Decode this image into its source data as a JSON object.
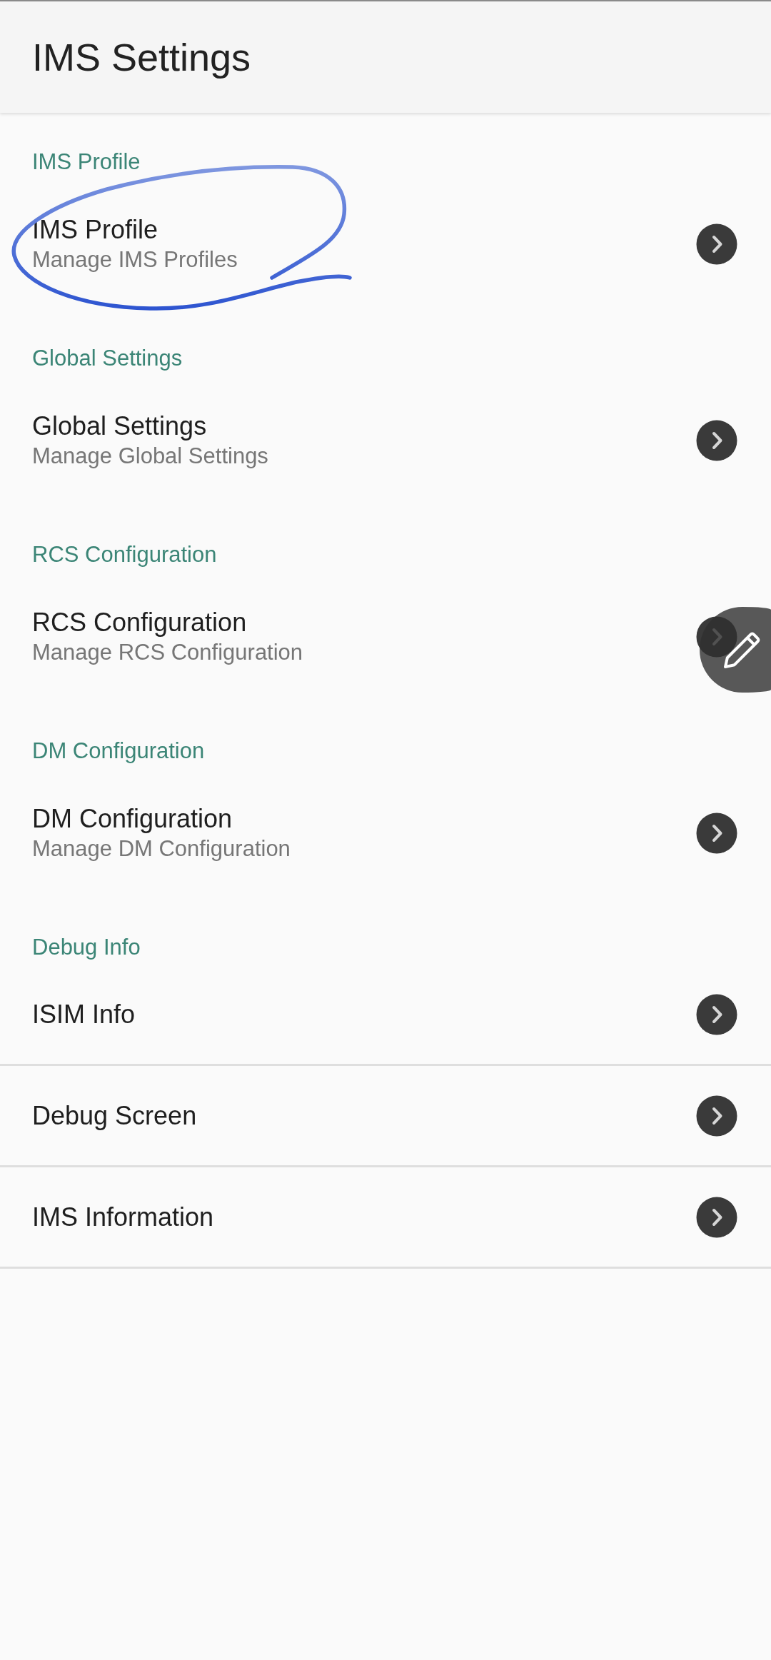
{
  "app_bar": {
    "title": "IMS Settings"
  },
  "sections": [
    {
      "header": "IMS Profile",
      "items": [
        {
          "title": "IMS Profile",
          "subtitle": "Manage IMS Profiles"
        }
      ]
    },
    {
      "header": "Global Settings",
      "items": [
        {
          "title": "Global Settings",
          "subtitle": "Manage Global Settings"
        }
      ]
    },
    {
      "header": "RCS Configuration",
      "items": [
        {
          "title": "RCS Configuration",
          "subtitle": "Manage RCS Configuration"
        }
      ]
    },
    {
      "header": "DM Configuration",
      "items": [
        {
          "title": "DM Configuration",
          "subtitle": "Manage DM Configuration"
        }
      ]
    },
    {
      "header": "Debug Info",
      "items": [
        {
          "title": "ISIM Info"
        },
        {
          "title": "Debug Screen"
        },
        {
          "title": "IMS Information"
        }
      ]
    }
  ]
}
